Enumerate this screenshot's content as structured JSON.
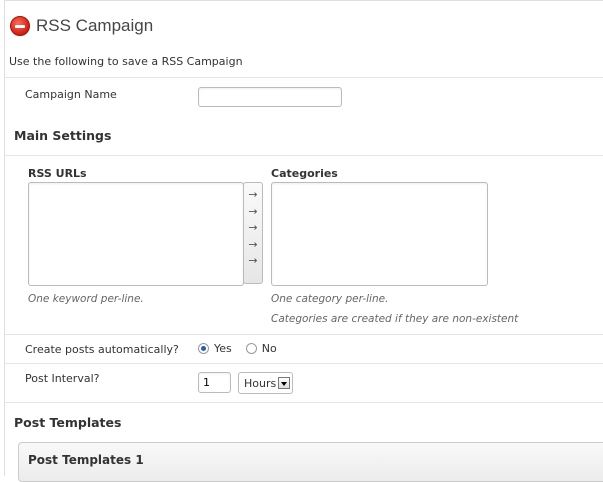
{
  "header": {
    "icon": "stop-icon",
    "title": "RSS Campaign",
    "intro": "Use the following to save a RSS Campaign"
  },
  "campaign": {
    "name_label": "Campaign Name",
    "name_value": ""
  },
  "main_settings": {
    "heading": "Main Settings",
    "rss_urls_label": "RSS URLs",
    "rss_urls_value": "",
    "rss_urls_hint": "One keyword per-line.",
    "categories_label": "Categories",
    "categories_value": "",
    "categories_hint_1": "One category per-line.",
    "categories_hint_2": "Categories are created if they are non-existent",
    "arrows": [
      "→",
      "→",
      "→",
      "→",
      "→"
    ]
  },
  "auto_post": {
    "label": "Create posts automatically?",
    "options": [
      {
        "label": "Yes",
        "checked": true
      },
      {
        "label": "No",
        "checked": false
      }
    ]
  },
  "interval": {
    "label": "Post Interval?",
    "value": "1",
    "unit": "Hours"
  },
  "templates": {
    "heading": "Post Templates",
    "panel_title": "Post Templates 1"
  },
  "colors": {
    "radio_selected": "#2a5db0",
    "stop_icon": "#d01f10"
  }
}
